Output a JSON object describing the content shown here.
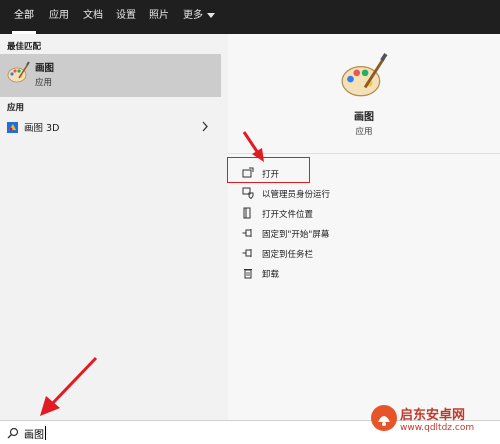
{
  "filters": {
    "tabs": [
      {
        "label": "全部",
        "active": true
      },
      {
        "label": "应用",
        "active": false
      },
      {
        "label": "文档",
        "active": false
      },
      {
        "label": "设置",
        "active": false
      },
      {
        "label": "照片",
        "active": false
      },
      {
        "label": "更多",
        "active": false,
        "has_dropdown": true
      }
    ]
  },
  "results": {
    "best_match_heading": "最佳匹配",
    "best_match": {
      "name": "画图",
      "type": "应用",
      "icon": "paint-palette-icon"
    },
    "apps_heading": "应用",
    "apps": [
      {
        "label": "画图 3D",
        "icon": "paint-3d-icon",
        "has_chevron": true
      }
    ]
  },
  "detail": {
    "app_name": "画图",
    "app_type": "应用",
    "actions": [
      {
        "label": "打开",
        "icon": "open-icon"
      },
      {
        "label": "以管理员身份运行",
        "icon": "admin-shield-icon"
      },
      {
        "label": "打开文件位置",
        "icon": "file-location-icon"
      },
      {
        "label": "固定到\"开始\"屏幕",
        "icon": "pin-start-icon"
      },
      {
        "label": "固定到任务栏",
        "icon": "pin-taskbar-icon"
      },
      {
        "label": "卸载",
        "icon": "trash-icon"
      }
    ]
  },
  "search": {
    "value": "画图",
    "icon": "search-icon"
  },
  "watermark": {
    "line1": "启东安卓网",
    "line2": "www.qdltdz.com"
  },
  "colors": {
    "topbar": "#1f1f1f",
    "selected": "#cccccc",
    "annotation_red": "#e21b23"
  }
}
